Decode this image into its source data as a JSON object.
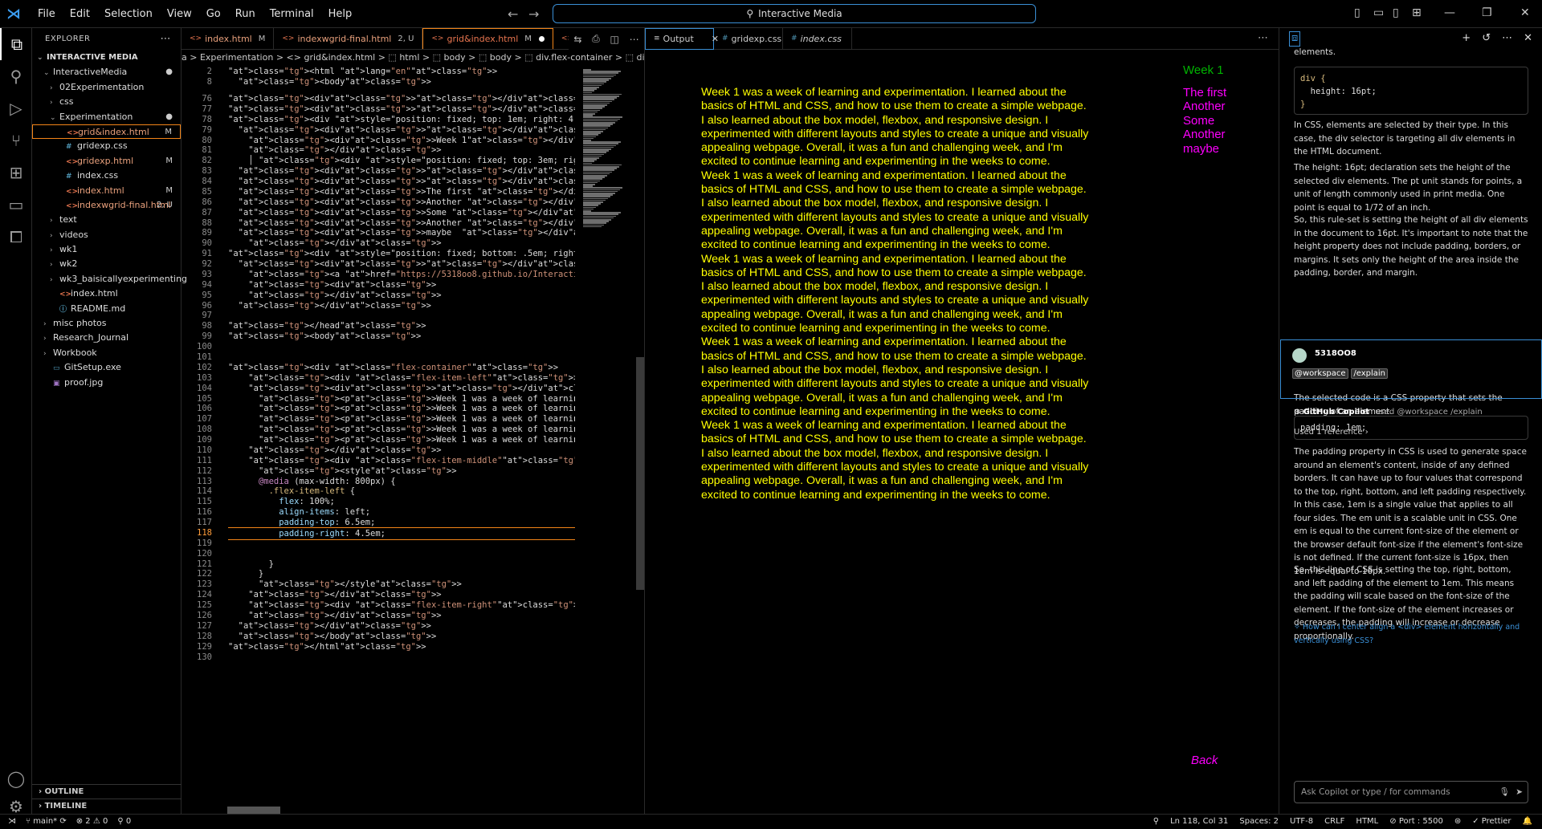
{
  "titlebar": {
    "menu": [
      "File",
      "Edit",
      "Selection",
      "View",
      "Go",
      "Run",
      "Terminal",
      "Help"
    ],
    "search": "Interactive Media"
  },
  "explorer": {
    "title": "EXPLORER",
    "root": "INTERACTIVE MEDIA",
    "items": [
      {
        "label": "InteractiveMedia",
        "indent": 1,
        "tw": "⌄",
        "type": "folder",
        "badge": "●"
      },
      {
        "label": "02Experimentation",
        "indent": 2,
        "tw": "›",
        "type": "folder",
        "badge": ""
      },
      {
        "label": "css",
        "indent": 2,
        "tw": "›",
        "type": "folder",
        "badge": ""
      },
      {
        "label": "Experimentation",
        "indent": 2,
        "tw": "⌄",
        "type": "folder",
        "badge": "●"
      },
      {
        "label": "grid&index.html",
        "indent": 3,
        "tw": "",
        "type": "html",
        "badge": "M",
        "selected": true
      },
      {
        "label": "gridexp.css",
        "indent": 3,
        "tw": "",
        "type": "css",
        "badge": ""
      },
      {
        "label": "gridexp.html",
        "indent": 3,
        "tw": "",
        "type": "html",
        "badge": "M"
      },
      {
        "label": "index.css",
        "indent": 3,
        "tw": "",
        "type": "css",
        "badge": ""
      },
      {
        "label": "index.html",
        "indent": 3,
        "tw": "",
        "type": "html",
        "badge": "M"
      },
      {
        "label": "indexwgrid-final.html",
        "indent": 3,
        "tw": "",
        "type": "html",
        "badge": "2, U"
      },
      {
        "label": "text",
        "indent": 2,
        "tw": "›",
        "type": "folder",
        "badge": ""
      },
      {
        "label": "videos",
        "indent": 2,
        "tw": "›",
        "type": "folder",
        "badge": ""
      },
      {
        "label": "wk1",
        "indent": 2,
        "tw": "›",
        "type": "folder",
        "badge": ""
      },
      {
        "label": "wk2",
        "indent": 2,
        "tw": "›",
        "type": "folder",
        "badge": ""
      },
      {
        "label": "wk3_baisicallyexperimenting",
        "indent": 2,
        "tw": "›",
        "type": "folder",
        "badge": ""
      },
      {
        "label": "index.html",
        "indent": 2,
        "tw": "",
        "type": "html",
        "badge": ""
      },
      {
        "label": "README.md",
        "indent": 2,
        "tw": "",
        "type": "md",
        "badge": ""
      },
      {
        "label": "misc photos",
        "indent": 1,
        "tw": "›",
        "type": "folder",
        "badge": ""
      },
      {
        "label": "Research_Journal",
        "indent": 1,
        "tw": "›",
        "type": "folder",
        "badge": ""
      },
      {
        "label": "Workbook",
        "indent": 1,
        "tw": "›",
        "type": "folder",
        "badge": ""
      },
      {
        "label": "GitSetup.exe",
        "indent": 1,
        "tw": "",
        "type": "exe",
        "badge": ""
      },
      {
        "label": "proof.jpg",
        "indent": 1,
        "tw": "",
        "type": "jpg",
        "badge": ""
      }
    ],
    "outline": "OUTLINE",
    "timeline": "TIMELINE"
  },
  "editor1": {
    "tabs": [
      {
        "label": "index.html",
        "mod": "M"
      },
      {
        "label": "indexwgrid-final.html",
        "mod": "2, U"
      },
      {
        "label": "grid&index.html",
        "mod": "M",
        "active": true
      },
      {
        "label": "grid",
        "mod": ""
      }
    ],
    "breadcrumb": "a > Experimentation > <> grid&index.html > ⬚ html > ⬚ body > ⬚ body > ⬚ div.flex-container > ⬚ div.flex-item-m",
    "current_line": 118,
    "lines": [
      {
        "n": "2",
        "t": "<html lang=\"en\">",
        "d": 0
      },
      {
        "n": "8",
        "t": "  <body>",
        "d": 0
      },
      {
        "n": "76",
        "t": "<div></div>",
        "d": 0
      },
      {
        "n": "77",
        "t": "<div></div>",
        "d": 0
      },
      {
        "n": "78",
        "t": "<div style=\"position: fixed; top: 1em; right: 4.8em; color: ■#0b3;",
        "d": 0
      },
      {
        "n": "79",
        "t": "  <div></div>",
        "d": 0
      },
      {
        "n": "80",
        "t": "    <div>Week 1</div>",
        "d": 0
      },
      {
        "n": "81",
        "t": "    </div>",
        "d": 0
      },
      {
        "n": "82",
        "t": "    │ <div style=\"position: fixed; top: 3em; right: 4.5em; color: ■",
        "d": 0
      },
      {
        "n": "83",
        "t": "  <div></div>",
        "d": 0
      },
      {
        "n": "84",
        "t": "  <div></div>",
        "d": 0
      },
      {
        "n": "85",
        "t": "  <div>The first </div>",
        "d": 0
      },
      {
        "n": "86",
        "t": "  <div>Another </div>",
        "d": 0
      },
      {
        "n": "87",
        "t": "  <div>Some </div>",
        "d": 0
      },
      {
        "n": "88",
        "t": "  <div>Another </div>",
        "d": 0
      },
      {
        "n": "89",
        "t": "  <div>maybe  </div>",
        "d": 0
      },
      {
        "n": "90",
        "t": "    </div>",
        "d": 0
      },
      {
        "n": "91",
        "t": "<div style=\"position: fixed; bottom: .5em; right: 3.5em; height: 60p",
        "d": 0
      },
      {
        "n": "92",
        "t": "  <div></div>",
        "d": 0
      },
      {
        "n": "93",
        "t": "    <a href=\"https://5318oo8.github.io/InteractiveMedia/\"><em>Back</",
        "d": 0
      },
      {
        "n": "94",
        "t": "    <div>",
        "d": 0
      },
      {
        "n": "95",
        "t": "    </div>",
        "d": 0
      },
      {
        "n": "96",
        "t": "  </div>",
        "d": 0
      },
      {
        "n": "97",
        "t": "",
        "d": 0
      },
      {
        "n": "98",
        "t": "</head>",
        "d": 0
      },
      {
        "n": "99",
        "t": "<body>",
        "d": 0
      },
      {
        "n": "100",
        "t": "",
        "d": 0
      },
      {
        "n": "101",
        "t": "",
        "d": 0
      },
      {
        "n": "102",
        "t": "<div class=\"flex-container\">",
        "d": 0
      },
      {
        "n": "103",
        "t": "    <div class=\"flex-item-left\">",
        "d": 0
      },
      {
        "n": "104",
        "t": "    <div></div>",
        "d": 0
      },
      {
        "n": "105",
        "t": "      <p>Week 1 was a week of learning and experimentation. I lear",
        "d": 0
      },
      {
        "n": "106",
        "t": "      <p>Week 1 was a week of learning and experimentation. I lear",
        "d": 0
      },
      {
        "n": "107",
        "t": "      <p>Week 1 was a week of learning and experimentation. I lear",
        "d": 0
      },
      {
        "n": "108",
        "t": "      <p>Week 1 was a week of learning and experimentation. I lear",
        "d": 0
      },
      {
        "n": "109",
        "t": "      <p>Week 1 was a week of learning and experimentation. I lear",
        "d": 0
      },
      {
        "n": "110",
        "t": "    </div>",
        "d": 0
      },
      {
        "n": "111",
        "t": "    <div class=\"flex-item-middle\">",
        "d": 0
      },
      {
        "n": "112",
        "t": "      <style>",
        "d": 0
      },
      {
        "n": "113",
        "t": "      @media (max-width: 800px) {",
        "d": 0
      },
      {
        "n": "114",
        "t": "        .flex-item-left {",
        "d": 0
      },
      {
        "n": "115",
        "t": "          flex: 100%;",
        "d": 0
      },
      {
        "n": "116",
        "t": "          align-items: left;",
        "d": 0
      },
      {
        "n": "117",
        "t": "          padding-top: 6.5em;",
        "d": 0
      },
      {
        "n": "118",
        "t": "          padding-right: 4.5em;",
        "d": 0
      },
      {
        "n": "119",
        "t": "",
        "d": 0
      },
      {
        "n": "120",
        "t": "",
        "d": 0
      },
      {
        "n": "121",
        "t": "        }",
        "d": 0
      },
      {
        "n": "122",
        "t": "      }",
        "d": 0
      },
      {
        "n": "123",
        "t": "      </style>",
        "d": 0
      },
      {
        "n": "124",
        "t": "    </div>",
        "d": 0
      },
      {
        "n": "125",
        "t": "    <div class=\"flex-item-right\">",
        "d": 0
      },
      {
        "n": "126",
        "t": "    </div>",
        "d": 0
      },
      {
        "n": "127",
        "t": "  </div>",
        "d": 0
      },
      {
        "n": "128",
        "t": "  </body>",
        "d": 0
      },
      {
        "n": "129",
        "t": "</html>",
        "d": 0
      },
      {
        "n": "130",
        "t": "",
        "d": 0
      }
    ]
  },
  "editor2": {
    "tabs": [
      {
        "label": "Output",
        "closable": true,
        "active": true
      },
      {
        "label": "gridexp.css",
        "closable": false
      },
      {
        "label": "index.css",
        "closable": false
      }
    ],
    "paragraph": "Week 1 was a week of learning and experimentation. I learned about the basics of HTML and CSS, and how to use them to create a simple webpage. I also learned about the box model, flexbox, and responsive design. I experimented with different layouts and styles to create a unique and visually appealing webpage. Overall, it was a fun and challenging week, and I'm excited to continue learning and experimenting in the weeks to come.",
    "paragraph_lines": [
      "Week 1 was a week of learning and experimentation. I learned about the",
      "basics of HTML and CSS, and how to use them to create a simple webpage.",
      "I also learned about the box model, flexbox, and responsive design. I",
      "experimented with different layouts and styles to create a unique and visually",
      "appealing webpage. Overall, it was a fun and challenging week, and I'm",
      "excited to continue learning and experimenting in the weeks to come."
    ],
    "repeat": 5,
    "week_label": "Week 1",
    "side_items": [
      "The first",
      "Another",
      "Some",
      "Another",
      "maybe"
    ],
    "back": "Back",
    "colors": {
      "text": "#ffff00",
      "week": "#00b300",
      "side": "#ff00ff"
    }
  },
  "copilot": {
    "top_text": "elements.",
    "code1": [
      "div {",
      "  height: 16pt;",
      "}"
    ],
    "p1": "In CSS, elements are selected by their type. In this case, the div selector is targeting all div elements in the HTML document.",
    "p2": "The height: 16pt; declaration sets the height of the selected div elements. The pt unit stands for points, a unit of length commonly used in print media. One point is equal to 1/72 of an inch.",
    "p3": "So, this rule-set is setting the height of all div elements in the document to 16pt. It's important to note that the height property does not include padding, borders, or margins. It sets only the height of the area inside the padding, border, and margin.",
    "user": "5318OO8",
    "user_cmds": [
      "@workspace",
      "/explain"
    ],
    "bot": "GitHub Copilot",
    "bot_used": "used @workspace /explain",
    "refs": "Used 1 reference",
    "p4": "The selected code is a CSS property that sets the padding of an element.",
    "code2": "padding: 1em;",
    "p5": "The padding property in CSS is used to generate space around an element's content, inside of any defined borders. It can have up to four values that correspond to the top, right, bottom, and left padding respectively.",
    "p6": "In this case, 1em is a single value that applies to all four sides. The em unit is a scalable unit in CSS. One em is equal to the current font-size of the element or the browser default font-size if the element's font-size is not defined. If the current font-size is 16px, then 1em is equal to 16px.",
    "p7": "So, this line of CSS is setting the top, right, bottom, and left padding of the element to 1em. This means the padding will scale based on the font-size of the element. If the font-size of the element increases or decreases, the padding will increase or decrease proportionally.",
    "suggestion": "How can I center align a <div> element horizontally and vertically using CSS?",
    "input_placeholder": "Ask Copilot or type / for commands"
  },
  "status": {
    "branch": "main*",
    "problems": "⊗ 2 ⚠ 0",
    "ports": "⚲ 0",
    "cursor": "Ln 118, Col 31",
    "spaces": "Spaces: 2",
    "encoding": "UTF-8",
    "eol": "CRLF",
    "lang": "HTML",
    "port": "Port : 5500",
    "prettier": "✓ Prettier"
  }
}
